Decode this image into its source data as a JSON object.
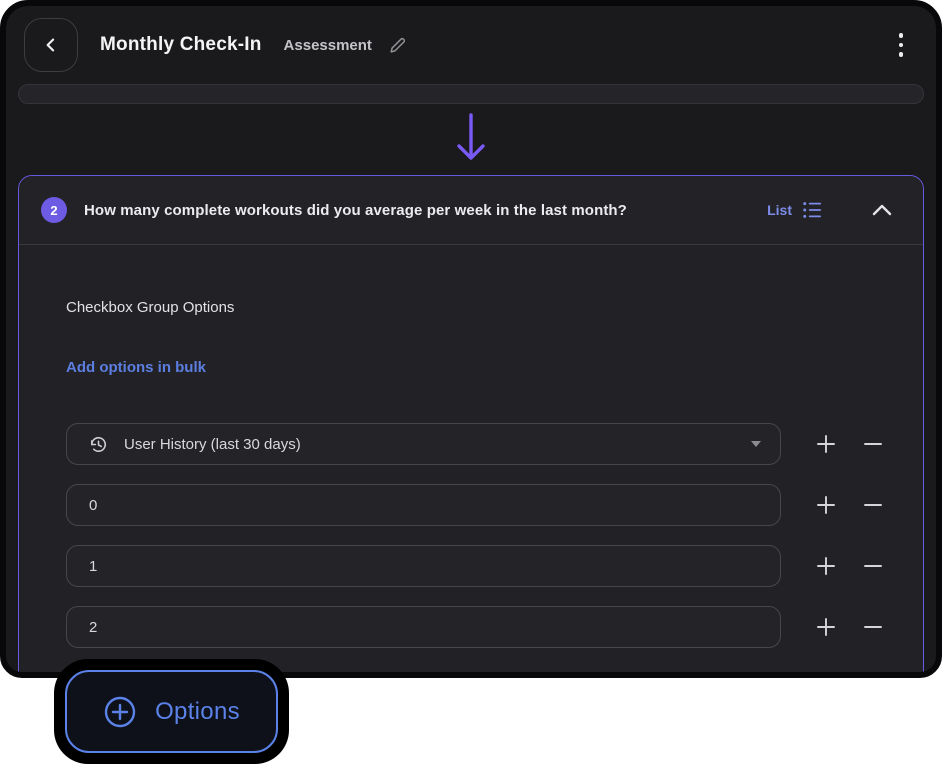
{
  "header": {
    "title": "Monthly Check-In",
    "subtitle": "Assessment",
    "back_icon": "chevron-left-icon",
    "edit_icon": "pencil-icon",
    "menu_icon": "kebab-menu-icon"
  },
  "connector": {
    "icon": "arrow-down-icon"
  },
  "question_card": {
    "badge": "2",
    "question": "How many complete workouts did you average per week in the last month?",
    "type_label": "List",
    "type_icon": "list-icon",
    "collapse_icon": "chevron-up-icon",
    "section_label": "Checkbox Group Options",
    "bulk_link": "Add options in bulk",
    "options": [
      {
        "value": "User History (last 30 days)",
        "leading_icon": "history-icon",
        "trailing_icon": "caret-down-icon"
      },
      {
        "value": "0"
      },
      {
        "value": "1"
      },
      {
        "value": "2"
      }
    ],
    "row_controls": {
      "add": "add-option",
      "remove": "remove-option"
    }
  },
  "options_button": {
    "label": "Options",
    "icon": "plus-circle-icon"
  },
  "colors": {
    "accent_purple": "#6C5CE7",
    "card_border_purple": "#675AE0",
    "link_blue": "#5C7EE0",
    "type_periwinkle": "#7D8BEB",
    "button_blue": "#5B82E8",
    "frame_bg": "#1A1A1D",
    "card_bg": "#222226"
  }
}
